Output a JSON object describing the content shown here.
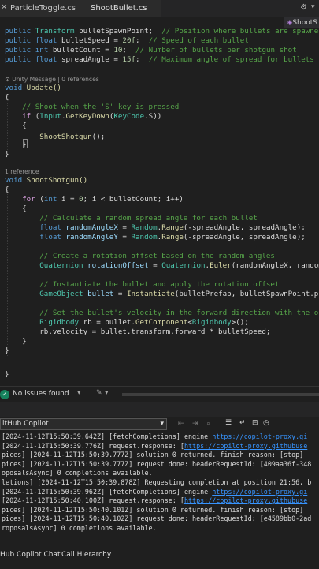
{
  "tabs": [
    {
      "label": "ParticleToggle.cs"
    },
    {
      "label": "ShootBullet.cs"
    }
  ],
  "sub_dropdown": "ShootS",
  "code": {
    "l1": {
      "kw": "public",
      "ty": "Transform",
      "name": " bulletSpawnPoint;  ",
      "cm": "// Position where bullets are spawned"
    },
    "l2": {
      "kw": "public",
      "ty": "float",
      "name": " bulletSpeed = ",
      "num": "20f",
      "rest": ";  ",
      "cm": "// Speed of each bullet"
    },
    "l3": {
      "kw": "public",
      "ty": "int",
      "name": " bulletCount = ",
      "num": "10",
      "rest": ";  ",
      "cm": "// Number of bullets per shotgun shot"
    },
    "l4": {
      "kw": "public",
      "ty": "float",
      "name": " spreadAngle = ",
      "num": "15f",
      "rest": ";  ",
      "cm": "// Maximum angle of spread for bullets"
    },
    "ref_update": "Unity Message | 0 references",
    "update_void": "void",
    "update_sig": " Update()",
    "open1": "{",
    "cm_shoot": "// Shoot when the 'S' key is pressed",
    "if_kw": "if",
    "if_p1": " (",
    "if_input": "Input",
    "if_dot": ".",
    "if_get": "GetKeyDown",
    "if_p2": "(",
    "if_keycode": "KeyCode",
    "if_s": ".S))",
    "open2": "{",
    "call": "ShootShotgun",
    "call_rest": "();",
    "close2": "}",
    "close1": "}",
    "ref_shoot": "1 reference",
    "shoot_void": "void",
    "shoot_sig": " ShootShotgun()",
    "open3": "{",
    "for_kw": "for",
    "for_p": " (",
    "for_int": "int",
    "for_i": " i = ",
    "for_0": "0",
    "for_rest": "; i < bulletCount; i++)",
    "open4": "{",
    "cm_calc": "// Calculate a random spread angle for each bullet",
    "rx_ty": "float",
    "rx_var": " randomAngleX",
    "rx_eq": " = ",
    "rx_cls": "Random",
    "rx_dot": ".",
    "rx_m": "Range",
    "rx_args": "(-spreadAngle, spreadAngle);",
    "ry_ty": "float",
    "ry_var": " randomAngleY",
    "ry_eq": " = ",
    "ry_cls": "Random",
    "ry_dot": ".",
    "ry_m": "Range",
    "ry_args": "(-spreadAngle, spreadAngle);",
    "cm_rot": "// Create a rotation offset based on the random angles",
    "q_ty": "Quaternion",
    "q_var": " rotationOffset",
    "q_eq": " = ",
    "q_cls": "Quaternion",
    "q_dot": ".",
    "q_m": "Euler",
    "q_args": "(randomAngleX, randomAng",
    "cm_inst": "// Instantiate the bullet and apply the rotation offset",
    "g_ty": "GameObject",
    "g_var": " bullet",
    "g_eq": " = ",
    "g_m": "Instantiate",
    "g_args": "(bulletPrefab, bulletSpawnPoint.posit",
    "cm_vel": "// Set the bullet's velocity in the forward direction with the offse",
    "rb_ty": "Rigidbody",
    "rb_rest": " rb = bullet.",
    "rb_m": "GetComponent",
    "rb_lt": "<",
    "rb_gen": "Rigidbody",
    "rb_gt": ">();",
    "vel": "rb.velocity = bullet.transform.forward * bulletSpeed;",
    "close4": "}",
    "close3": "}",
    "close0": "}"
  },
  "status": {
    "issues": "No issues found"
  },
  "output_source": "itHub Copilot",
  "output_lines": [
    {
      "pre": "[2024-11-12T15:50:39.642Z] [fetchCompletions] engine ",
      "link": "https://copilot-proxy.gi",
      "post": ""
    },
    {
      "pre": "[2024-11-12T15:50:39.776Z] request.response: [",
      "link": "https://copilot-proxy.githubuse",
      "post": ""
    },
    {
      "pre": "pices] [2024-11-12T15:50:39.777Z] solution 0 returned. finish reason: [stop]",
      "link": "",
      "post": ""
    },
    {
      "pre": "pices] [2024-11-12T15:50:39.777Z] request done: headerRequestId: [409aa36f-348",
      "link": "",
      "post": ""
    },
    {
      "pre": "oposalsAsync] 0 completions available.",
      "link": "",
      "post": ""
    },
    {
      "pre": "letions] [2024-11-12T15:50:39.878Z] Requesting completion at position 21:56, b",
      "link": "",
      "post": ""
    },
    {
      "pre": "[2024-11-12T15:50:39.962Z] [fetchCompletions] engine ",
      "link": "https://copilot-proxy.gi",
      "post": ""
    },
    {
      "pre": "[2024-11-12T15:50:40.100Z] request.response: [",
      "link": "https://copilot-proxy.githubuse",
      "post": ""
    },
    {
      "pre": "pices] [2024-11-12T15:50:40.101Z] solution 0 returned. finish reason: [stop]",
      "link": "",
      "post": ""
    },
    {
      "pre": "pices] [2024-11-12T15:50:40.102Z] request done: headerRequestId: [e4589bb0-2ad",
      "link": "",
      "post": ""
    },
    {
      "pre": "roposalsAsync] 0 completions available.",
      "link": "",
      "post": ""
    }
  ],
  "bottom_tabs": [
    {
      "label": "Hub Copilot Chat"
    },
    {
      "label": "Call Hierarchy"
    }
  ],
  "colors": {
    "keyword": "#569cd6",
    "type": "#4ec9b0",
    "comment": "#57a64a",
    "method": "#dcdcaa",
    "link": "#3794ff"
  }
}
